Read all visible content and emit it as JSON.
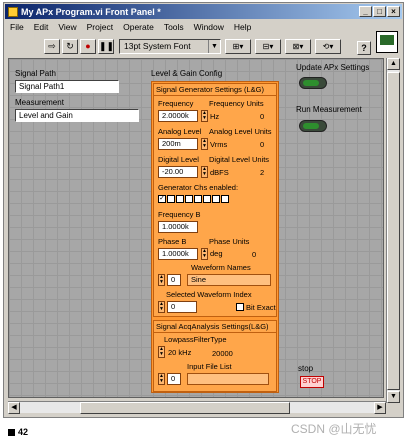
{
  "window": {
    "title": "My APx Program.vi Front Panel *",
    "controls": [
      "_",
      "□",
      "×"
    ]
  },
  "menubar": [
    "File",
    "Edit",
    "View",
    "Project",
    "Operate",
    "Tools",
    "Window",
    "Help"
  ],
  "toolbar": {
    "font": "13pt System Font",
    "help": "?"
  },
  "panel": {
    "signal_path_label": "Signal Path",
    "signal_path_value": "Signal Path1",
    "measurement_label": "Measurement",
    "measurement_value": "Level and Gain",
    "cluster_label": "Level & Gain Config",
    "gen_settings_title": "Signal Generator Settings (L&G)",
    "frequency_label": "Frequency",
    "frequency_value": "2.0000k",
    "frequency_units_label": "Frequency Units",
    "frequency_units_value": "Hz",
    "frequency_units_index": "0",
    "analog_level_label": "Analog Level",
    "analog_level_value": "200m",
    "analog_level_units_label": "Analog Level Units",
    "analog_level_units_value": "Vrms",
    "analog_level_units_index": "0",
    "digital_level_label": "Digital Level",
    "digital_level_value": "-20.00",
    "digital_level_units_label": "Digital Level Units",
    "digital_level_units_value": "dBFS",
    "digital_level_units_index": "2",
    "gen_chs_label": "Generator Chs enabled:",
    "gen_chs": [
      true,
      false,
      false,
      false,
      false,
      false,
      false,
      false
    ],
    "frequency_b_label": "Frequency B",
    "frequency_b_value": "1.0000k",
    "phase_b_label": "Phase B",
    "phase_b_value": "1.0000k",
    "phase_units_label": "Phase Units",
    "phase_units_value": "deg",
    "phase_units_index": "0",
    "waveform_names_label": "Waveform Names",
    "waveform_names_index": "0",
    "waveform_names_value": "Sine",
    "selected_waveform_label": "Selected Waveform Index",
    "selected_waveform_value": "0",
    "bit_exact_label": "Bit Exact",
    "acq_title": "Signal AcqAnalysis Settings(L&G)",
    "lowpass_label": "LowpassFilterType",
    "lowpass_value": "20 kHz",
    "lowpass_number": "20000",
    "input_file_list_label": "Input File List",
    "input_file_list_index": "0",
    "update_label": "Update APx Settings",
    "run_label": "Run Measurement",
    "stop_label": "stop",
    "stop_button": "STOP"
  },
  "caption": "42",
  "watermark": "CSDN @山无忧"
}
